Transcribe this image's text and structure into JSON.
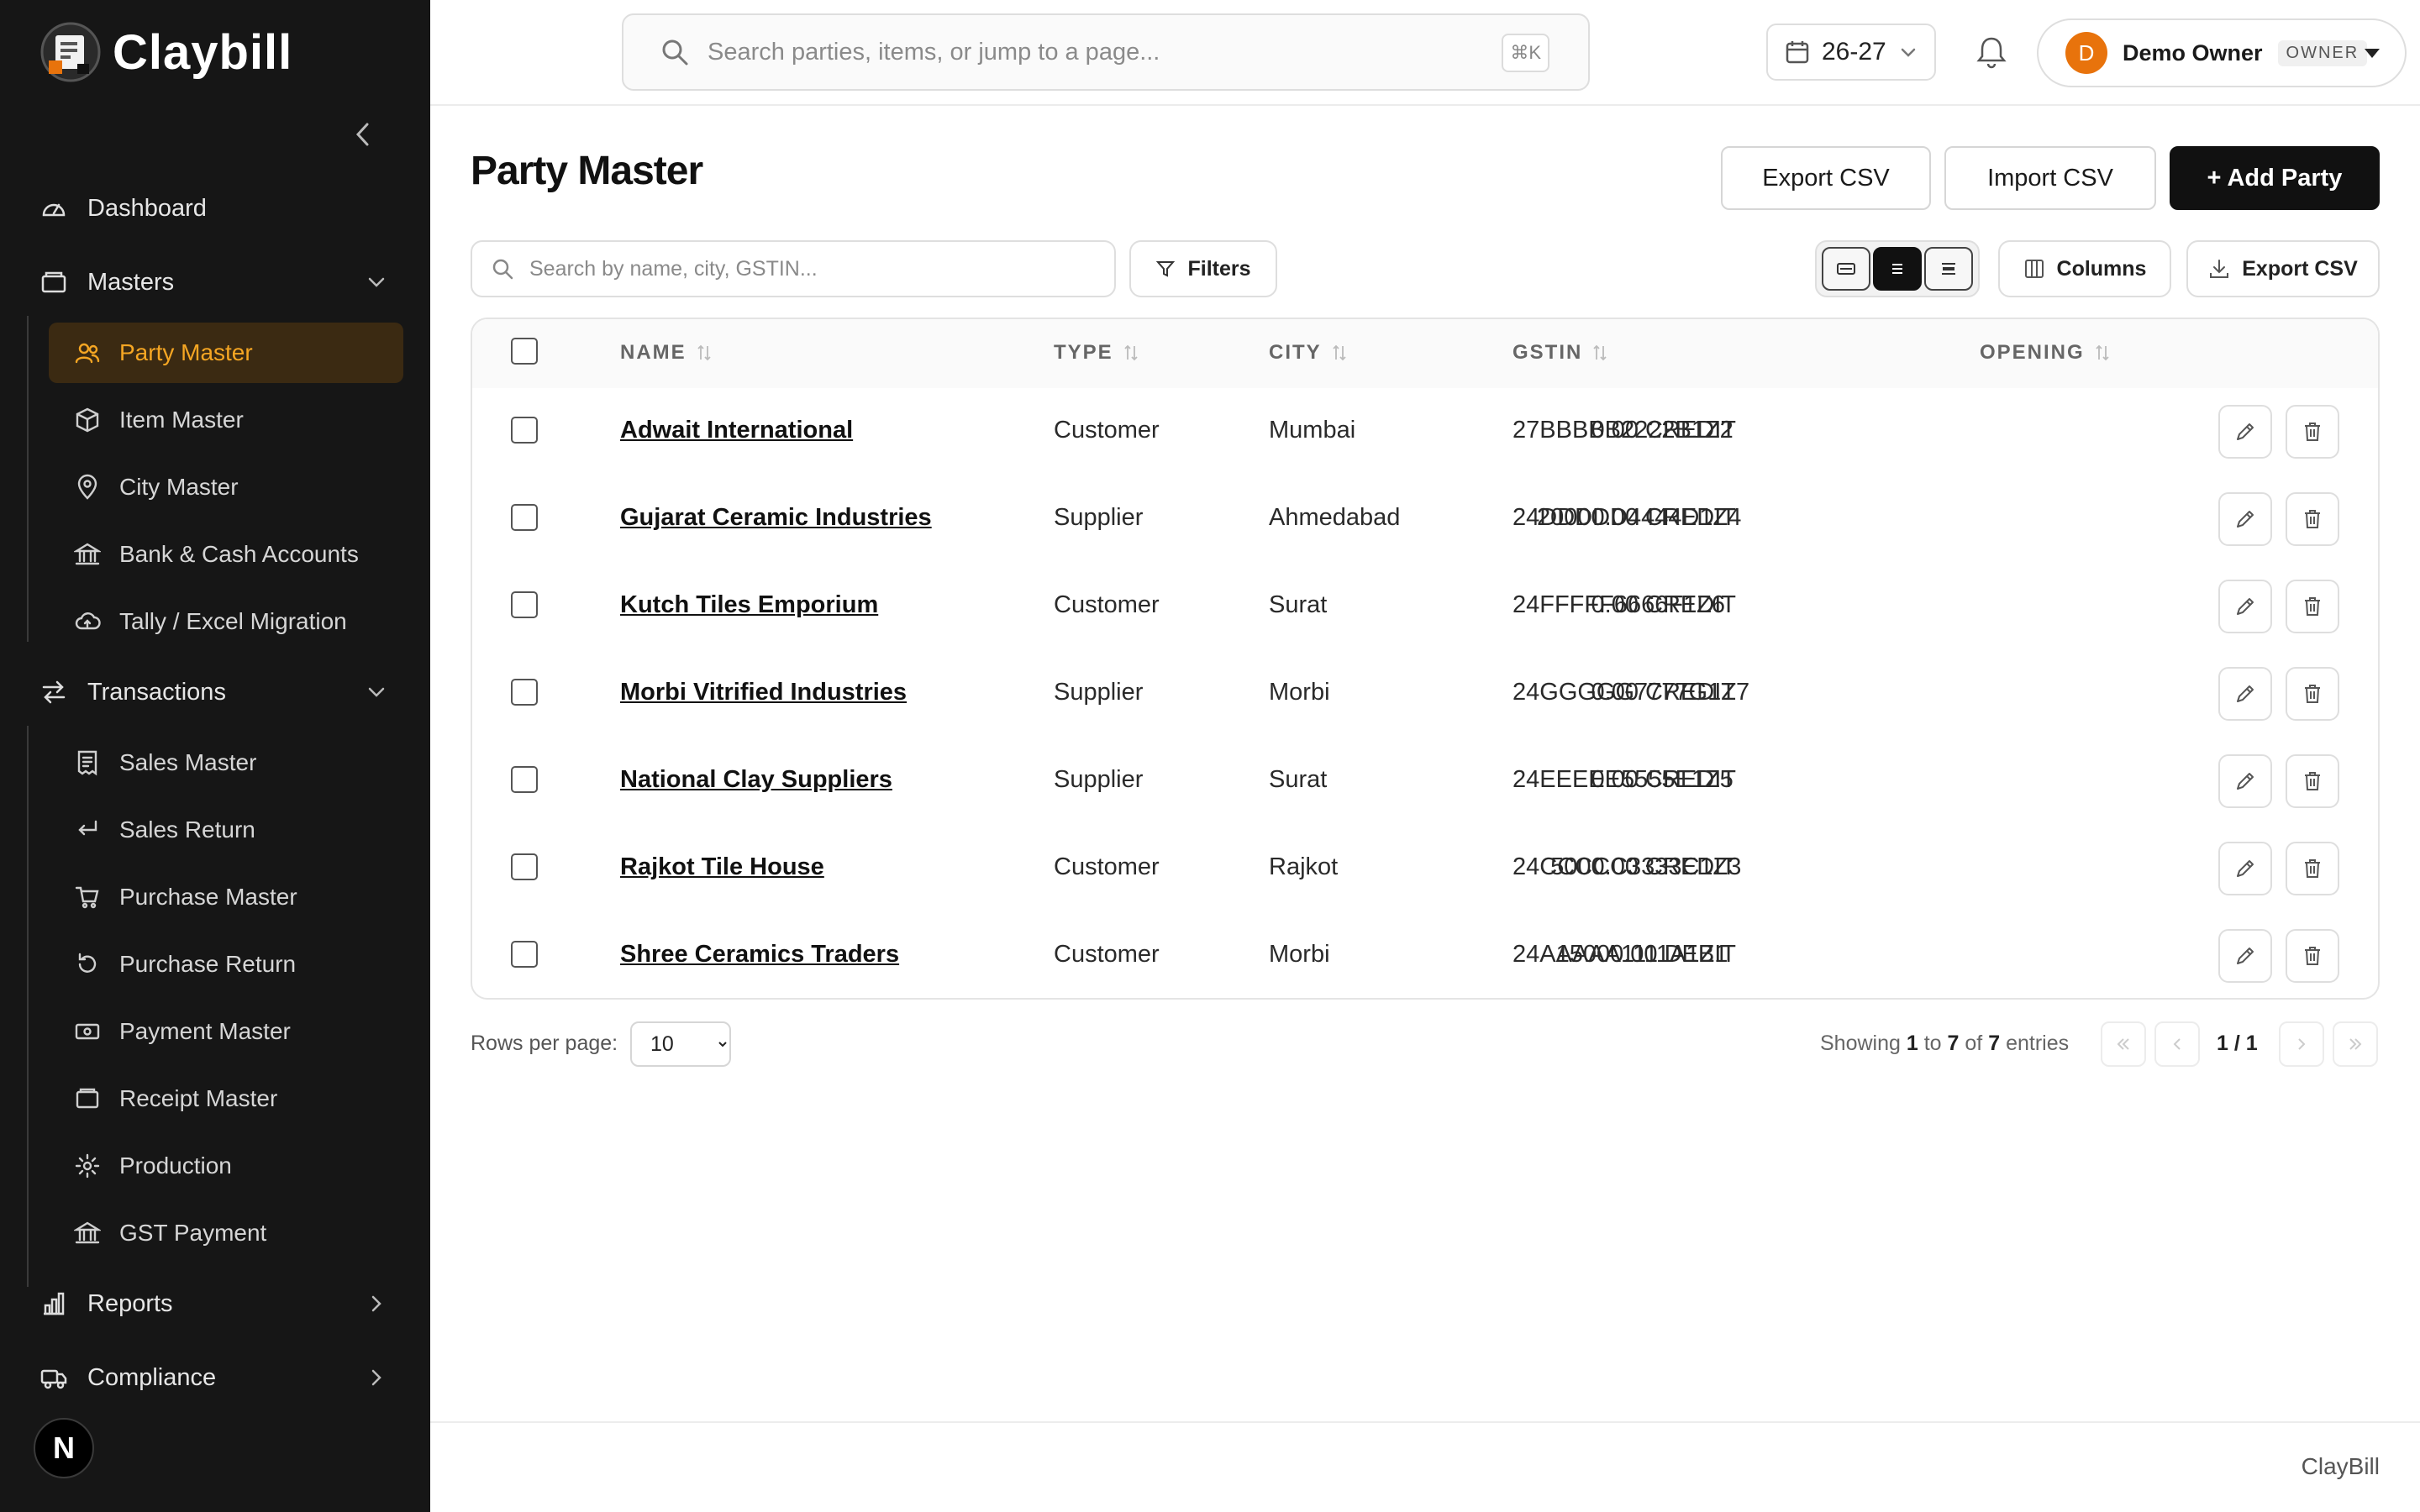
{
  "app": {
    "name": "Claybill"
  },
  "sidebar": {
    "groups": {
      "dashboard": "Dashboard",
      "masters": "Masters",
      "transactions": "Transactions",
      "reports": "Reports",
      "compliance": "Compliance"
    },
    "masters_items": [
      {
        "label": "Party Master",
        "icon": "users-icon",
        "active": true
      },
      {
        "label": "Item Master",
        "icon": "box-icon"
      },
      {
        "label": "City Master",
        "icon": "map-pin-icon"
      },
      {
        "label": "Bank & Cash Accounts",
        "icon": "bank-icon"
      },
      {
        "label": "Tally / Excel Migration",
        "icon": "cloud-upload-icon"
      }
    ],
    "transaction_items": [
      {
        "label": "Sales Master",
        "icon": "receipt-icon"
      },
      {
        "label": "Sales Return",
        "icon": "return-arrow-icon"
      },
      {
        "label": "Purchase Master",
        "icon": "cart-icon"
      },
      {
        "label": "Purchase Return",
        "icon": "rotate-icon"
      },
      {
        "label": "Payment Master",
        "icon": "cash-icon"
      },
      {
        "label": "Receipt Master",
        "icon": "wallet-icon"
      },
      {
        "label": "Production",
        "icon": "gear-icon"
      },
      {
        "label": "GST Payment",
        "icon": "bank-icon"
      }
    ],
    "badge": "N"
  },
  "topbar": {
    "search_placeholder": "Search parties, items, or jump to a page...",
    "shortcut": "⌘K",
    "fiscal_year": "26-27",
    "user": {
      "initial": "D",
      "name": "Demo Owner",
      "role": "OWNER"
    }
  },
  "page": {
    "title": "Party Master",
    "actions": {
      "export": "Export CSV",
      "import": "Import CSV",
      "add": "+ Add Party"
    },
    "toolbar": {
      "search_placeholder": "Search by name, city, GSTIN...",
      "filters": "Filters",
      "columns": "Columns",
      "export": "Export CSV",
      "density_selected": "normal"
    }
  },
  "table": {
    "headers": {
      "name": "NAME",
      "type": "TYPE",
      "city": "CITY",
      "gstin": "GSTIN",
      "opening": "OPENING"
    },
    "rows": [
      {
        "name": "Adwait International",
        "type": "Customer",
        "city": "Mumbai",
        "gstin": "27BBBBB2222B1Z2",
        "opening": "0.00 CREDIT"
      },
      {
        "name": "Gujarat Ceramic Industries",
        "type": "Supplier",
        "city": "Ahmedabad",
        "gstin": "24DDDDD4444D1Z4",
        "opening": "20000.00 CREDIT"
      },
      {
        "name": "Kutch Tiles Emporium",
        "type": "Customer",
        "city": "Surat",
        "gstin": "24FFFFF6666F1Z6",
        "opening": "0.00 CREDIT"
      },
      {
        "name": "Morbi Vitrified Industries",
        "type": "Supplier",
        "city": "Morbi",
        "gstin": "24GGGGG7777G1Z7",
        "opening": "0.00 CREDIT"
      },
      {
        "name": "National Clay Suppliers",
        "type": "Supplier",
        "city": "Surat",
        "gstin": "24EEEEE5555E1Z5",
        "opening": "0.00 CREDIT"
      },
      {
        "name": "Rajkot Tile House",
        "type": "Customer",
        "city": "Rajkot",
        "gstin": "24CCCCC3333C1Z3",
        "opening": "5000.00 CREDIT"
      },
      {
        "name": "Shree Ceramics Traders",
        "type": "Customer",
        "city": "Morbi",
        "gstin": "24AAAAA1111A1Z1",
        "opening": "15000.00 DEBIT"
      }
    ]
  },
  "pagination": {
    "rows_label": "Rows per page:",
    "rows_per_page": "10",
    "showing_prefix": "Showing",
    "from": "1",
    "to_word": "to",
    "to": "7",
    "of_word": "of",
    "total": "7",
    "entries_word": "entries",
    "page": "1 / 1"
  },
  "footer": {
    "text": "ClayBill"
  },
  "colors": {
    "accent": "#f5a623",
    "sidebar_bg": "#161616",
    "primary_button": "#111111"
  }
}
